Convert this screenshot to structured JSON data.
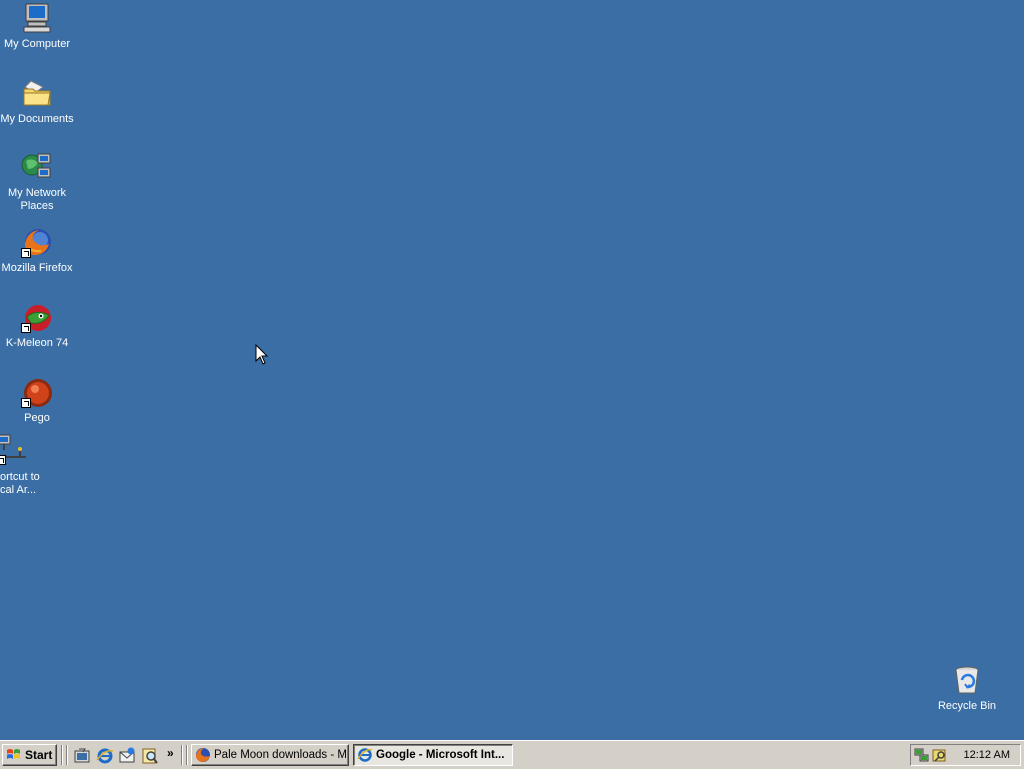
{
  "desktop": {
    "background": "#3a6ea5",
    "icons": [
      {
        "label": "My Computer",
        "icon": "computer-icon"
      },
      {
        "label": "My Documents",
        "icon": "folder-icon"
      },
      {
        "label": "My Network Places",
        "icon": "network-icon"
      },
      {
        "label": "Mozilla Firefox",
        "icon": "firefox-icon"
      },
      {
        "label": "K-Meleon 74",
        "icon": "kmeleon-icon"
      },
      {
        "label": "Pego",
        "icon": "pego-icon"
      },
      {
        "label": "ortcut to cal Ar...",
        "icon": "lan-connection-icon"
      }
    ],
    "recycle_bin": {
      "label": "Recycle Bin",
      "icon": "recycle-bin-icon"
    }
  },
  "taskbar": {
    "start_label": "Start",
    "quick_launch": [
      "desktop-icon",
      "internet-explorer-icon",
      "outlook-express-icon",
      "search-icon"
    ],
    "overflow_label": "»",
    "tasks": [
      {
        "label": "Pale Moon downloads - M...",
        "icon": "firefox-icon",
        "active": false
      },
      {
        "label": "Google - Microsoft Int...",
        "icon": "internet-explorer-icon",
        "active": true
      }
    ],
    "tray": {
      "icons": [
        "network-tray-icon",
        "security-tray-icon"
      ],
      "clock": "12:12 AM"
    }
  }
}
